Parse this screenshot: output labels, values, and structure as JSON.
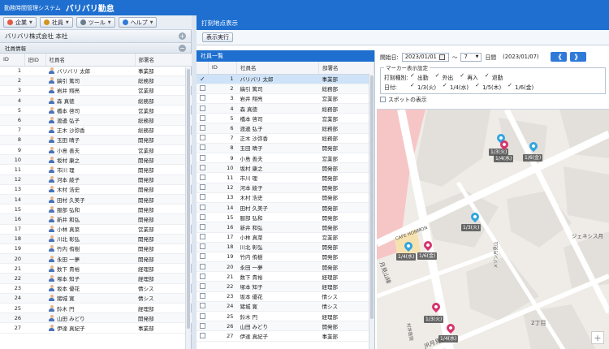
{
  "app": {
    "system_name": "勤務時間管理システム",
    "title": "バリバリ勤怠"
  },
  "toolbar": [
    {
      "label": "企業",
      "icon": "building-icon",
      "color": "#e05a47"
    },
    {
      "label": "社員",
      "icon": "person-icon",
      "color": "#d4941f"
    },
    {
      "label": "ツール",
      "icon": "tool-icon",
      "color": "#6b7c8f"
    },
    {
      "label": "ヘルプ",
      "icon": "help-icon",
      "color": "#2f7ad8"
    }
  ],
  "left_panel": {
    "company": "バリバリ株式会社 本社",
    "section": "社員情報",
    "columns": [
      "ID",
      "旧ID",
      "社員名",
      "部署名"
    ]
  },
  "right_panel": {
    "title": "打刻地点表示",
    "show_button": "表示実行",
    "list_title": "社員一覧",
    "columns": [
      "ID",
      "社員名",
      "部署名"
    ]
  },
  "employees": [
    {
      "id": "1",
      "name": "バリバリ 太郎",
      "dept": "事業部"
    },
    {
      "id": "2",
      "name": "縞引 篤司",
      "dept": "総務部"
    },
    {
      "id": "3",
      "name": "岩井 翔亮",
      "dept": "営業部"
    },
    {
      "id": "4",
      "name": "森 真徳",
      "dept": "総務部"
    },
    {
      "id": "5",
      "name": "橋本 啓司",
      "dept": "営業部"
    },
    {
      "id": "6",
      "name": "渡邊 弘子",
      "dept": "総務部"
    },
    {
      "id": "7",
      "name": "正木 沙弥香",
      "dept": "総務部"
    },
    {
      "id": "8",
      "name": "玉田 晴子",
      "dept": "開発部"
    },
    {
      "id": "9",
      "name": "小島 善夫",
      "dept": "営業部"
    },
    {
      "id": "10",
      "name": "坂村 康之",
      "dept": "開発部"
    },
    {
      "id": "11",
      "name": "市川 理",
      "dept": "開発部"
    },
    {
      "id": "12",
      "name": "河本 綾子",
      "dept": "開発部"
    },
    {
      "id": "13",
      "name": "木村 浩史",
      "dept": "開発部"
    },
    {
      "id": "14",
      "name": "田村 久美子",
      "dept": "開発部"
    },
    {
      "id": "15",
      "name": "服部 弘和",
      "dept": "開発部"
    },
    {
      "id": "16",
      "name": "新井 和弘",
      "dept": "開発部"
    },
    {
      "id": "17",
      "name": "小林 真菜",
      "dept": "営業部"
    },
    {
      "id": "18",
      "name": "川北 彰弘",
      "dept": "開発部"
    },
    {
      "id": "19",
      "name": "竹内 侑樹",
      "dept": "開発部"
    },
    {
      "id": "20",
      "name": "永田 一夢",
      "dept": "開発部"
    },
    {
      "id": "21",
      "name": "数下 貴裕",
      "dept": "経理部"
    },
    {
      "id": "22",
      "name": "塚本 知子",
      "dept": "経理部"
    },
    {
      "id": "23",
      "name": "坂本 優花",
      "dept": "情シス"
    },
    {
      "id": "24",
      "name": "猪城 寛",
      "dept": "情シス"
    },
    {
      "id": "25",
      "name": "鈴木 円",
      "dept": "経理部"
    },
    {
      "id": "26",
      "name": "山田 みどり",
      "dept": "開発部"
    },
    {
      "id": "27",
      "name": "伊達 真紀子",
      "dept": "事業部"
    }
  ],
  "controls": {
    "start_label": "開始日:",
    "start_date": "2023/01/01",
    "range_sep": "～",
    "days_value": "7",
    "days_unit": "日間",
    "end_date": "(2023/01/07)",
    "prev_label": "《",
    "next_label": "》",
    "marker_legend": "マーカー表示設定",
    "type_label": "打刻種別:",
    "types": [
      "出勤",
      "外出",
      "再入",
      "退勤"
    ],
    "date_label": "日付:",
    "dates": [
      "1/3(火)",
      "1/4(水)",
      "1/5(木)",
      "1/6(金)"
    ],
    "spot_label": "スポットの表示"
  },
  "map": {
    "labels": [
      "CAFE HONMON",
      "ジェネシス月",
      "2丁目",
      "月見山線",
      "メゾン月見山",
      "JR月見山",
      "村井医院"
    ],
    "markers": [
      {
        "label": "1/6(金)",
        "color": "#2fa6e0"
      },
      {
        "label": "1/3(火)",
        "color": "#2fa6e0"
      },
      {
        "label": "1/4(水)",
        "color": "#d6336c"
      },
      {
        "label": "1/3(火)",
        "color": "#2fa6e0"
      },
      {
        "label": "1/4(水)",
        "color": "#2fa6e0"
      },
      {
        "label": "1/6(金)",
        "color": "#d6336c"
      },
      {
        "label": "1/3(火)",
        "color": "#d6336c"
      },
      {
        "label": "1/4(水)",
        "color": "#d6336c"
      }
    ]
  },
  "colors": {
    "brand": "#1e6fd0",
    "selected_row": "#cfe3f8"
  }
}
